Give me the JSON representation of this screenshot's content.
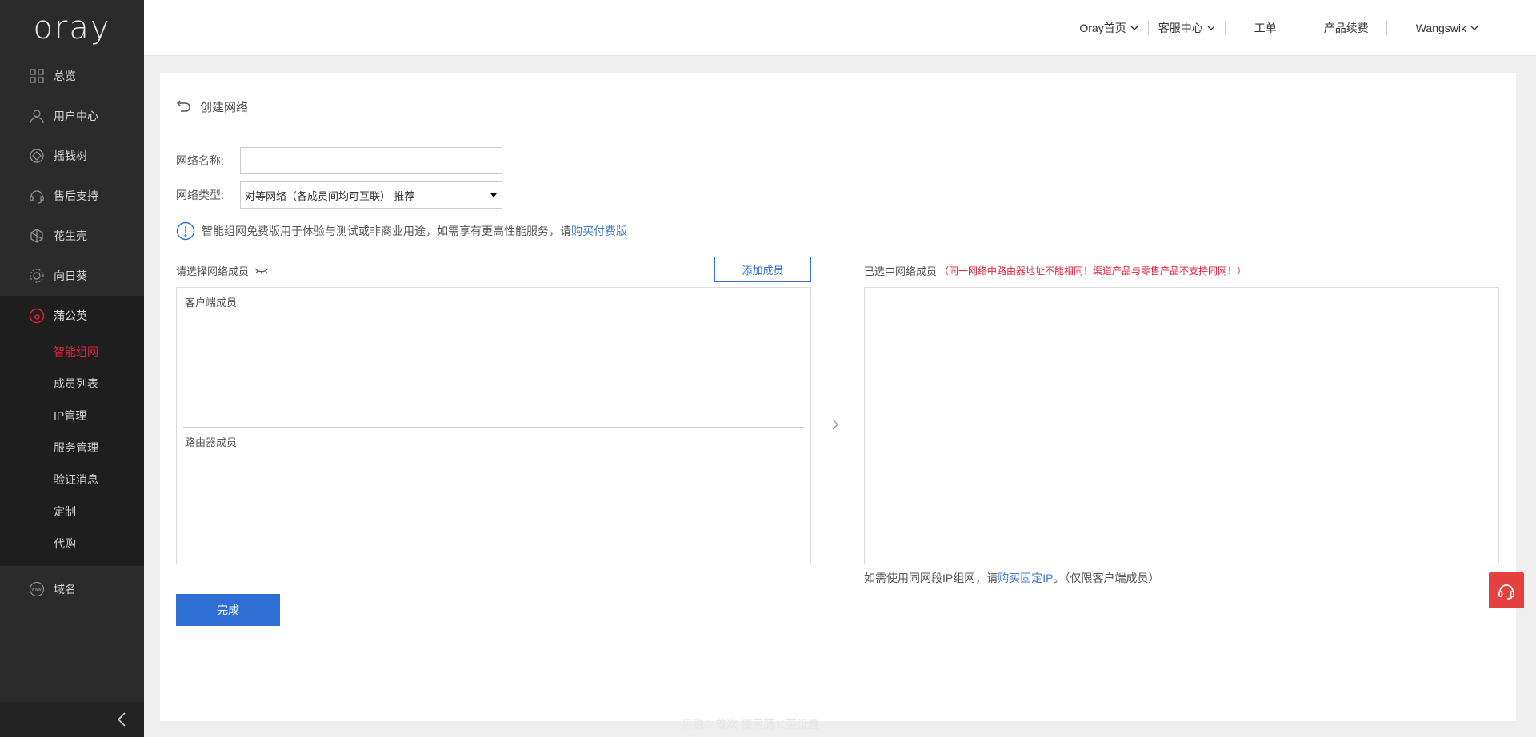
{
  "brand": {
    "logo_text": "oray"
  },
  "sidebar": {
    "items": [
      {
        "label": "总览",
        "icon": "grid-icon"
      },
      {
        "label": "用户中心",
        "icon": "user-icon"
      },
      {
        "label": "摇钱树",
        "icon": "diamond-icon"
      },
      {
        "label": "售后支持",
        "icon": "headset-icon"
      },
      {
        "label": "花生壳",
        "icon": "shell-icon"
      },
      {
        "label": "向日葵",
        "icon": "sunflower-icon"
      }
    ],
    "active_group": {
      "label": "蒲公英",
      "icon": "dandelion-icon",
      "sub_items": [
        "智能组网",
        "成员列表",
        "IP管理",
        "服务管理",
        "验证消息",
        "定制",
        "代购"
      ],
      "active_sub": "智能组网"
    },
    "after_items": [
      {
        "label": "域名",
        "icon": "www-icon"
      }
    ]
  },
  "header": {
    "nav": [
      "Oray首页",
      "客服中心",
      "工单",
      "产品续费",
      "Wangswik"
    ]
  },
  "page": {
    "title": "创建网络",
    "network_name_label": "网络名称:",
    "network_name_value": "",
    "network_type_label": "网络类型:",
    "network_type_value": "对等网络（各成员间均可互联）-推荐",
    "notice_text": "智能组网免费版用于体验与测试或非商业用途，如需享有更高性能服务，请",
    "notice_link": "购买付费版",
    "select_members_label": "请选择网络成员",
    "add_member_button": "添加成员",
    "client_members_title": "客户端成员",
    "router_members_title": "路由器成员",
    "selected_members_label": "已选中网络成员",
    "selected_members_warning": "（同一网络中路由器地址不能相同！渠道产品与零售产品不支持同网！）",
    "hint_prefix": "如需使用同网段IP组网，请",
    "hint_link": "购买固定IP",
    "hint_suffix": "。（仅限客户端成员）",
    "done_button": "完成",
    "footer_text": "贝锐© 首次 使用蒲公英设置"
  },
  "colors": {
    "sidebar_bg": "#2b2b2b",
    "accent_red": "#e5213b",
    "primary_blue": "#2f6fd3",
    "link_blue": "#3f7ad1"
  }
}
